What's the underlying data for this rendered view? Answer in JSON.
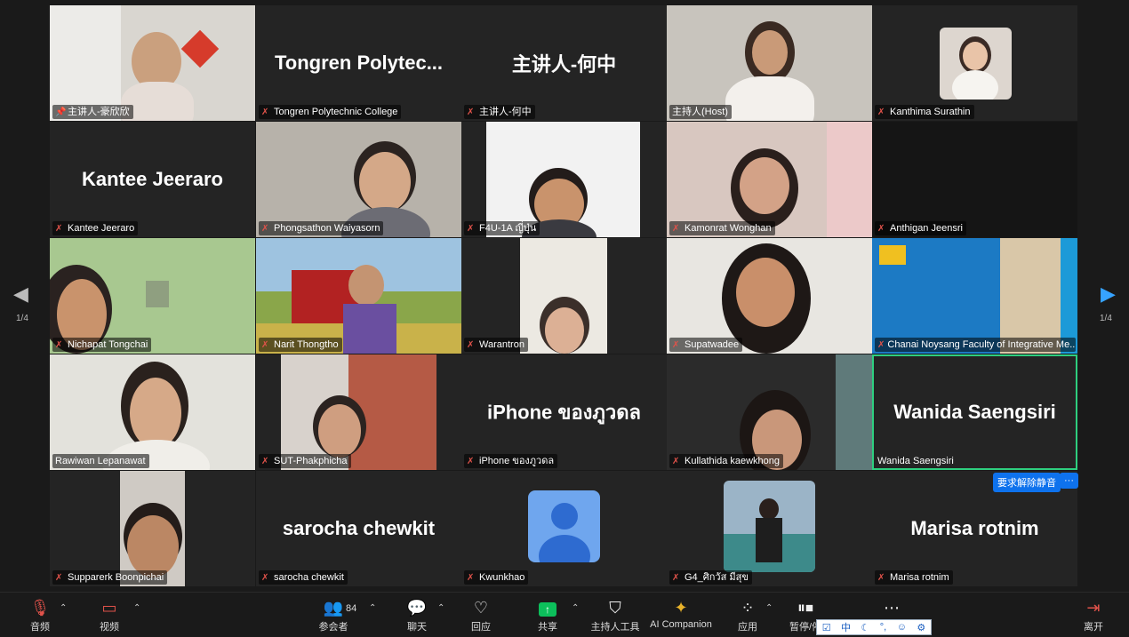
{
  "tiles": [
    {
      "label": "主讲人-豪欣欣",
      "big": ""
    },
    {
      "label": "Tongren Polytechnic College",
      "big": "Tongren  Polytec..."
    },
    {
      "label": "主讲人-何中",
      "big": "主讲人-何中"
    },
    {
      "label": "主持人(Host)",
      "big": ""
    },
    {
      "label": "Kanthima Surathin",
      "big": ""
    },
    {
      "label": "Kantee Jeeraro",
      "big": "Kantee Jeeraro"
    },
    {
      "label": "Phongsathon Waiyasorn",
      "big": ""
    },
    {
      "label": "F4U-1A ญี่ปุ่น",
      "big": ""
    },
    {
      "label": "Kamonrat Wonghan",
      "big": ""
    },
    {
      "label": "Anthigan Jeensri",
      "big": ""
    },
    {
      "label": "Nichapat Tongchai",
      "big": ""
    },
    {
      "label": "Narit Thongtho",
      "big": ""
    },
    {
      "label": "Warantron",
      "big": ""
    },
    {
      "label": "Supatwadee",
      "big": ""
    },
    {
      "label": "Chanai Noysang Faculty of Integrative Me...",
      "big": ""
    },
    {
      "label": "Rawiwan Lepanawat",
      "big": ""
    },
    {
      "label": "SUT-Phakphicha",
      "big": ""
    },
    {
      "label": "iPhone ของภูวดล",
      "big": "iPhone ของภูวดล"
    },
    {
      "label": "Kullathida kaewkhong",
      "big": ""
    },
    {
      "label": "Wanida Saengsiri",
      "big": "Wanida Saengsiri"
    },
    {
      "label": "Supparerk Boonpichai",
      "big": ""
    },
    {
      "label": "sarocha chewkit",
      "big": "sarocha chewkit"
    },
    {
      "label": "Kwunkhao",
      "big": ""
    },
    {
      "label": "G4_ศิกวัส มีสุข",
      "big": ""
    },
    {
      "label": "Marisa rotnim",
      "big": "Marisa rotnim"
    }
  ],
  "nav": {
    "left_page": "1/4",
    "right_page": "1/4"
  },
  "actions": {
    "unmute_request": "要求解除静音",
    "more": "···"
  },
  "toolbar": {
    "audio": "音频",
    "video": "视频",
    "participants": "参会者",
    "participants_count": "84",
    "chat": "聊天",
    "react": "回应",
    "share": "共享",
    "host_tools": "主持人工具",
    "ai": "AI Companion",
    "apps": "应用",
    "pause": "暂停/停",
    "leave": "离开"
  },
  "ime": {
    "lang": "中"
  },
  "colors": {
    "accent": "#0e72ed",
    "highlight": "#2ecf7f",
    "muted": "#e0524a",
    "share": "#0cbf5b"
  }
}
